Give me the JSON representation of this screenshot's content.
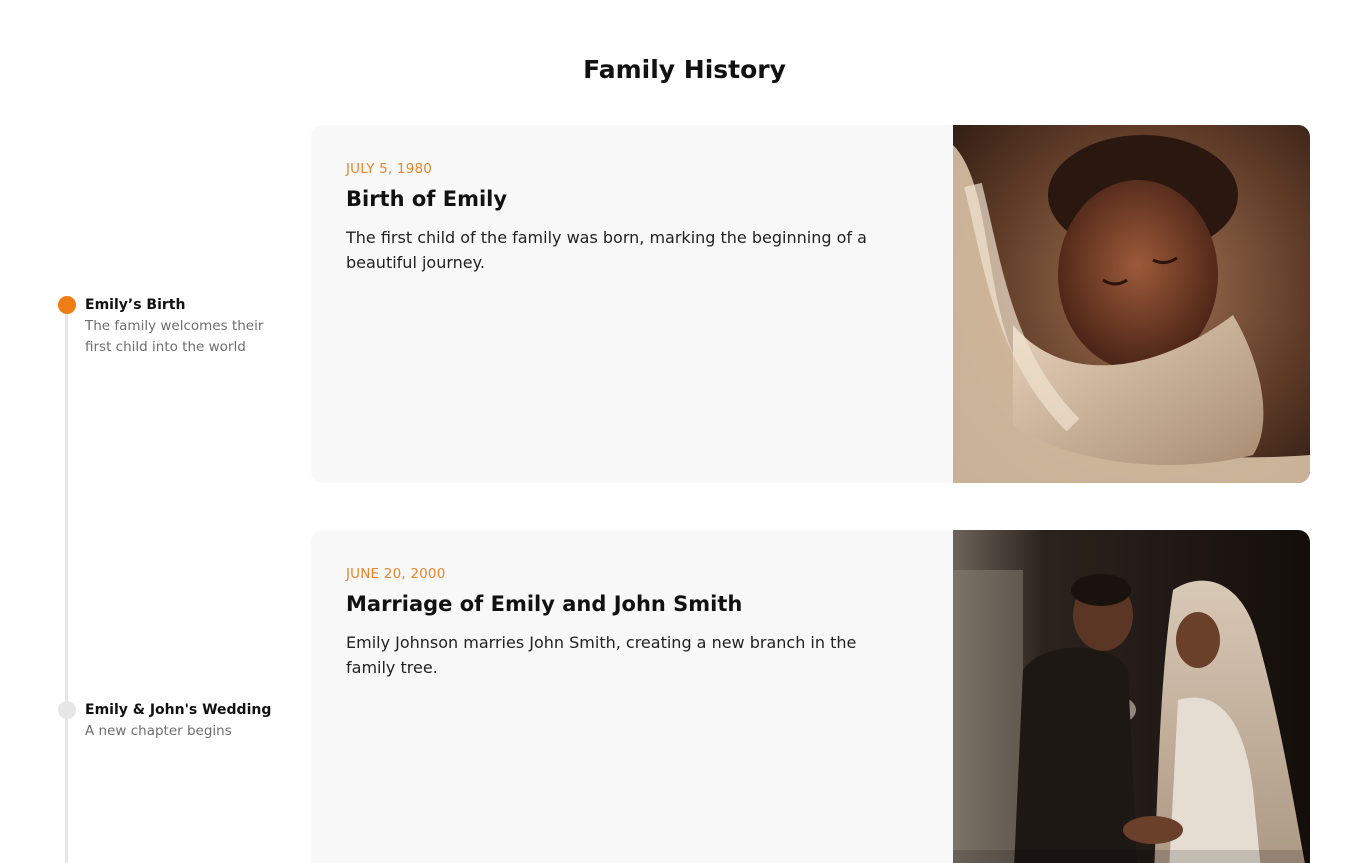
{
  "page": {
    "title": "Family History"
  },
  "timeline": [
    {
      "title": "Emily’s Birth",
      "description": "The family welcomes their first child into the world",
      "active": true
    },
    {
      "title": "Emily & John's Wedding",
      "description": "A new chapter begins",
      "active": false
    }
  ],
  "events": [
    {
      "date": "JULY 5, 1980",
      "title": "Birth of Emily",
      "description": "The first child of the family was born, marking the beginning of a beautiful journey."
    },
    {
      "date": "JUNE 20, 2000",
      "title": "Marriage of Emily and John Smith",
      "description": "Emily Johnson marries John Smith, creating a new branch in the family tree."
    }
  ],
  "colors": {
    "accent": "#f07c14",
    "date": "#e8852c",
    "card_bg": "#f8f8f8",
    "inactive_dot": "#e6e6e6"
  }
}
